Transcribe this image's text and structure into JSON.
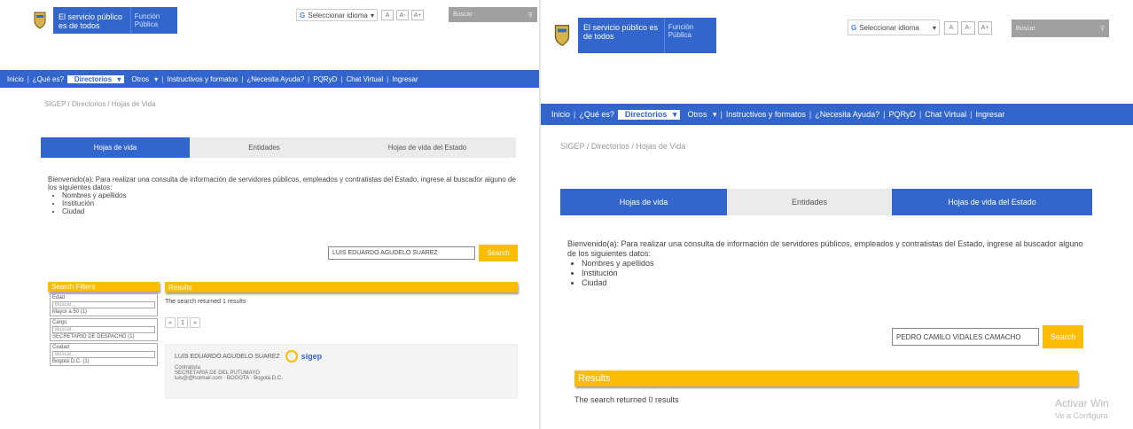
{
  "brand": {
    "line1": "El servicio público es de todos",
    "line2": "Función Pública"
  },
  "lang_label": "Seleccionar idioma",
  "access_btns": [
    "A",
    "A-",
    "A+"
  ],
  "search_placeholder": "Buscar",
  "nav": [
    "Inicio",
    "¿Qué es?",
    "Directorios",
    "Otros",
    "Instructivos y formatos",
    "¿Necesita Ayuda?",
    "PQRyD",
    "Chat Virtual",
    "Ingresar"
  ],
  "breadcrumb": "SIGEP / Directorios / Hojas de Vida",
  "tabs": [
    "Hojas de vida",
    "Entidades",
    "Hojas de vida del Estado"
  ],
  "intro": "Bienvenido(a): Para realizar una consulta de información de servidores públicos, empleados y contratistas del Estado, ingrese al buscador alguno de los siguientes datos:",
  "criteria": [
    "Nombres y apellidos",
    "Institución",
    "Ciudad"
  ],
  "left": {
    "query": "LUIS EDUARDO AGUDELO SUAREZ",
    "search_label": "Search",
    "filters_title": "Search Filters",
    "results_title": "Results",
    "results_text": "The search returned 1 results",
    "pager": [
      "«",
      "1",
      "»"
    ],
    "facets": [
      {
        "title": "Edad",
        "input": "Buscar...",
        "value": "Mayor a 50 (1)"
      },
      {
        "title": "Cargo",
        "input": "Buscar...",
        "value": "SECRETARIO DE DESPACHO (1)"
      },
      {
        "title": "Ciudad",
        "input": "Buscar...",
        "value": "Bogotá D.C. (1)"
      }
    ],
    "card": {
      "name": "LUIS EDUARDO AGUDELO SUAREZ",
      "logo": "sigep",
      "role": "Contratista",
      "entity": "SECRETARIA DE DEL PUTUMAYO",
      "contact": "luis@@hotmail.com · BOGOTA · Bogotá D.C."
    }
  },
  "right": {
    "query": "PEDRO CAMILO VIDALES CAMACHO",
    "search_label": "Search",
    "results_title": "Results",
    "results_text": "The search returned 0 results"
  },
  "watermark": {
    "line1": "Activar Win",
    "line2": "Ve a Configura"
  },
  "colors": {
    "primary": "#3366cc",
    "accent": "#fbbc05"
  }
}
